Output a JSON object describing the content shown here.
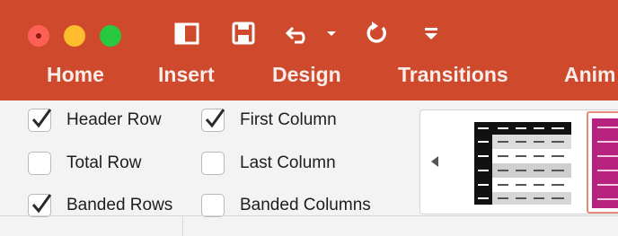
{
  "window": {
    "traffic_lights": [
      "close-button",
      "minimize-button",
      "zoom-button"
    ]
  },
  "quick_access": {
    "icons": [
      "sidebar-icon",
      "save-icon",
      "undo-icon",
      "redo-icon",
      "customize-icon"
    ]
  },
  "tabs": [
    {
      "label": "Home"
    },
    {
      "label": "Insert"
    },
    {
      "label": "Design"
    },
    {
      "label": "Transitions"
    },
    {
      "label": "Anim"
    }
  ],
  "table_style_options": {
    "header_row": {
      "label": "Header Row",
      "checked": true
    },
    "total_row": {
      "label": "Total Row",
      "checked": false
    },
    "banded_rows": {
      "label": "Banded Rows",
      "checked": true
    },
    "first_column": {
      "label": "First Column",
      "checked": true
    },
    "last_column": {
      "label": "Last Column",
      "checked": false
    },
    "banded_columns": {
      "label": "Banded Columns",
      "checked": false
    }
  },
  "colors": {
    "title_bar": "#cf4a2d",
    "ribbon": "#f3f3f3",
    "style_magenta": "#b6227e"
  }
}
